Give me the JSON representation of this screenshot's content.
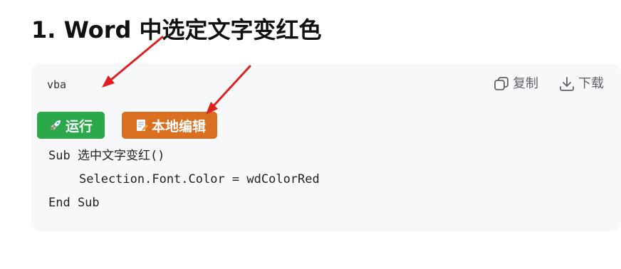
{
  "heading": "1. Word 中选定文字变红色",
  "code_block": {
    "language": "vba",
    "copy_label": "复制",
    "download_label": "下载",
    "run_label": "运行",
    "edit_label": "本地编辑",
    "lines": [
      "Sub 选中文字变红()",
      "Selection.Font.Color = wdColorRed",
      "End Sub"
    ]
  },
  "colors": {
    "run_button": "#2aa84a",
    "edit_button": "#d97021",
    "annotation_arrow": "#e02020",
    "card_background": "#f7f8fa"
  },
  "icons": {
    "copy": "copy-icon",
    "download": "download-icon",
    "run": "rocket-icon",
    "edit": "memo-icon",
    "annotation": "red-arrow"
  }
}
